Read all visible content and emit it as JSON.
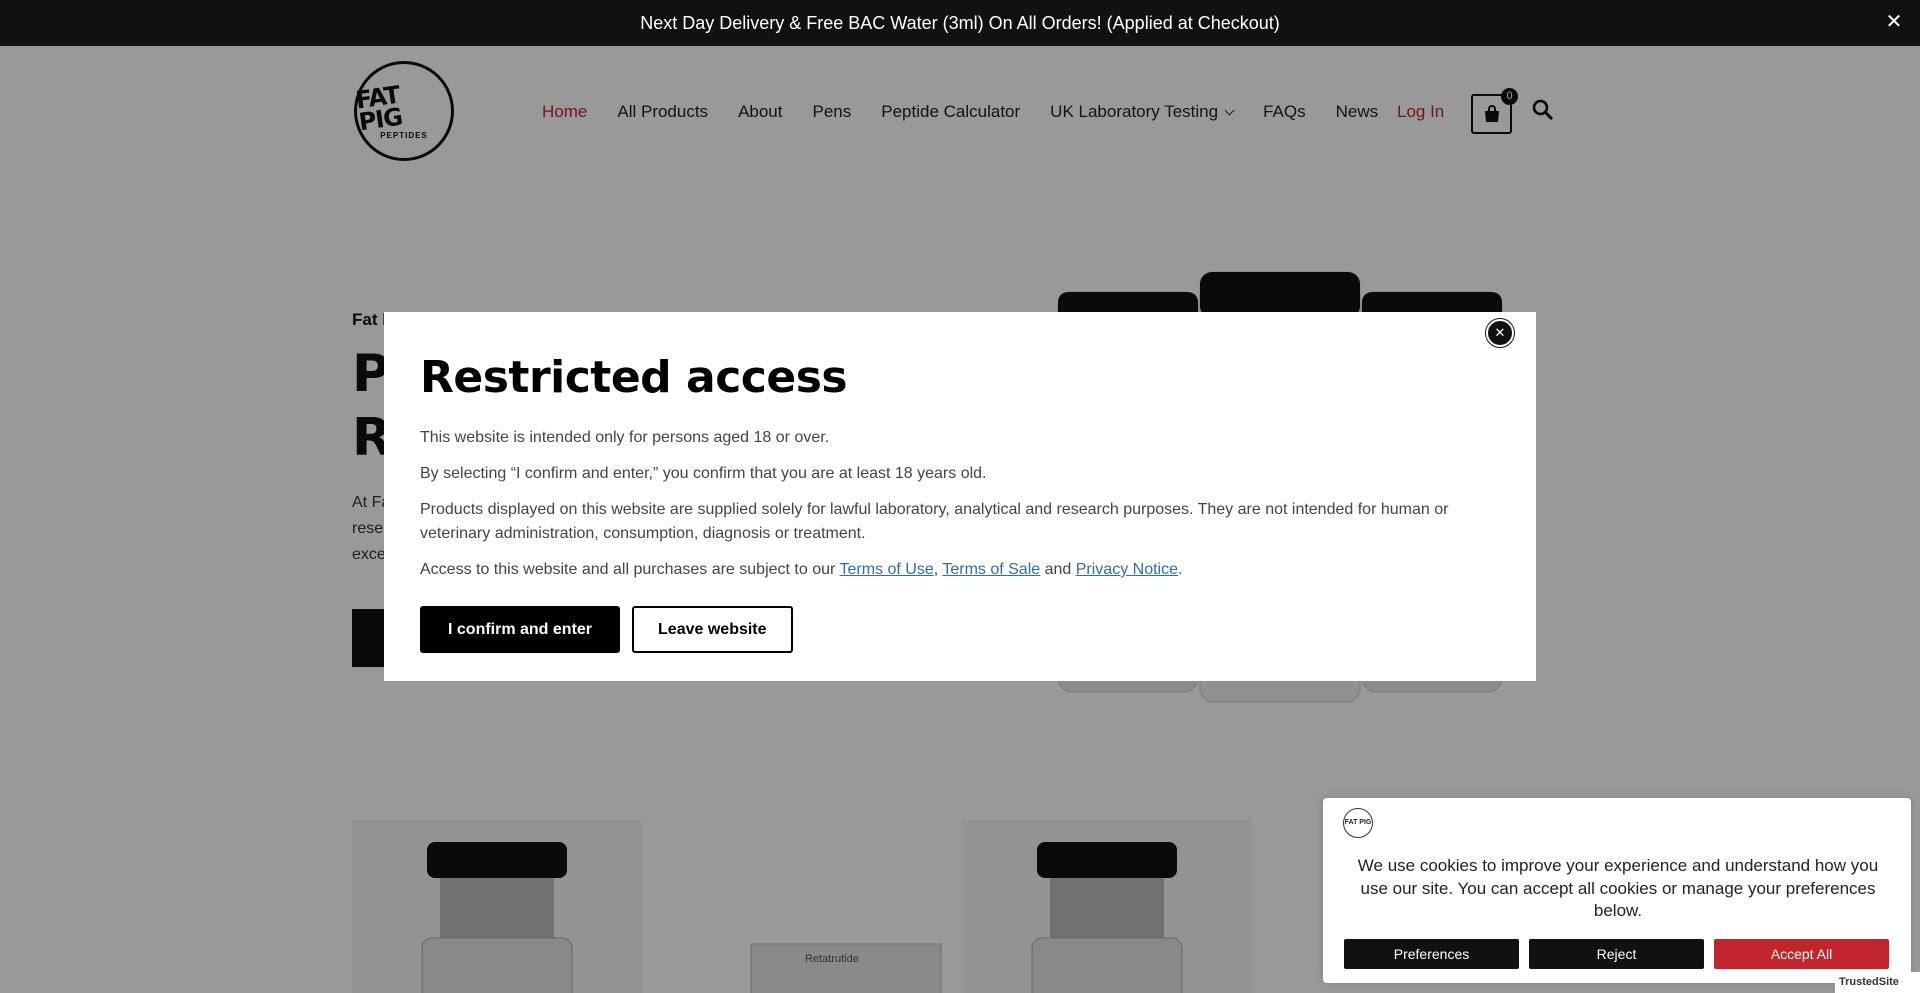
{
  "announcement": {
    "text": "Next Day Delivery & Free BAC Water (3ml) On All Orders! (Applied at Checkout)",
    "close_symbol": "✕"
  },
  "header": {
    "logo_text": "FAT PIG",
    "logo_subtext": "PEPTIDES",
    "nav": [
      {
        "label": "Home",
        "active": true
      },
      {
        "label": "All Products"
      },
      {
        "label": "About"
      },
      {
        "label": "Pens"
      },
      {
        "label": "Peptide Calculator"
      },
      {
        "label": "UK Laboratory Testing",
        "has_dropdown": true
      },
      {
        "label": "FAQs"
      },
      {
        "label": "News"
      }
    ],
    "login_label": "Log In",
    "cart_count": "0",
    "accent_color": "#c0262c"
  },
  "hero": {
    "kicker": "Fat P",
    "title_line1": "P",
    "title_line2": "R",
    "body_line1": "At Fa",
    "body_line2": "rese",
    "body_line3": "exce"
  },
  "modal": {
    "title": "Restricted access",
    "p1": "This website is intended only for persons aged 18 or over.",
    "p2": "By selecting “I confirm and enter,” you confirm that you are at least 18 years old.",
    "p3": "Products displayed on this website are supplied solely for lawful laboratory, analytical and research purposes. They are not intended for human or veterinary administration, consumption, diagnosis or treatment.",
    "p4_prefix": "Access to this website and all purchases are subject to our ",
    "terms_of_use": "Terms of Use",
    "comma": ",",
    "terms_of_sale": "Terms of Sale",
    "and": " and ",
    "privacy_notice": "Privacy Notice",
    "period": ".",
    "confirm_label": "I confirm and enter",
    "leave_label": "Leave website",
    "close_symbol": "✕"
  },
  "products": {
    "box_label": "Retatrutide"
  },
  "cookie": {
    "text": "We use cookies to improve your experience and understand how you use our site. You can accept all cookies or manage your preferences below.",
    "preferences_label": "Preferences",
    "reject_label": "Reject",
    "accept_label": "Accept All",
    "trusted_label": "TrustedSite"
  }
}
